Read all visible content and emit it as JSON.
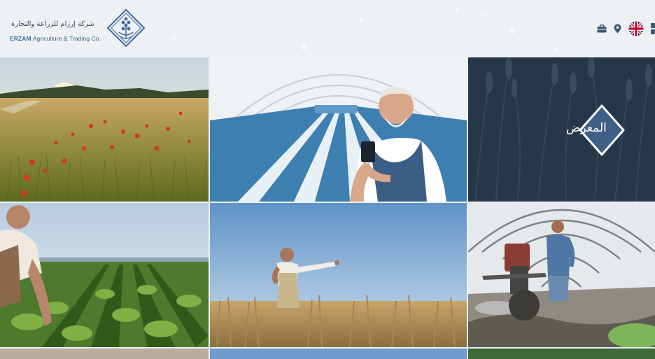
{
  "brand": {
    "name_ar": "شركة إرزام للزراعة والتجارة",
    "name_en_strong": "ERZAM",
    "name_en_rest": " Agriculture & Trading Co."
  },
  "header": {
    "icons": [
      "briefcase-icon",
      "location-pin-icon",
      "uk-flag-icon",
      "menu-icon"
    ]
  },
  "tiles": {
    "gallery_label": "المعرض"
  },
  "colors": {
    "background": "#eef1f4",
    "brand_blue": "#3d6a9c",
    "dark_panel": "#27374a"
  }
}
